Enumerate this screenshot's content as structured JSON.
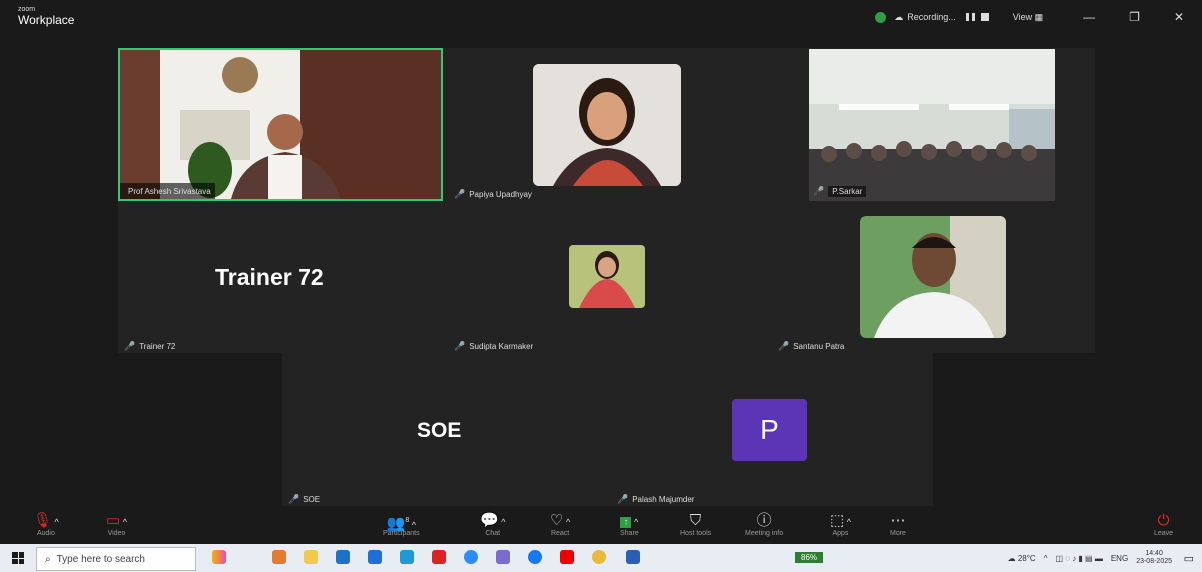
{
  "app": {
    "brand_small": "zoom",
    "brand_big": "Workplace"
  },
  "titlebar": {
    "recording_label": "Recording...",
    "view_label": "View",
    "minimize": "—",
    "restore": "❐",
    "close": "✕"
  },
  "participants": [
    {
      "name": "Prof Ashesh Srivastava",
      "display": "",
      "type": "video",
      "active": true
    },
    {
      "name": "Papiya Upadhyay",
      "display": "",
      "type": "video"
    },
    {
      "name": "P.Sarkar",
      "display": "",
      "type": "video"
    },
    {
      "name": "Trainer 72",
      "display": "Trainer 72",
      "type": "name-only"
    },
    {
      "name": "Sudipta Karmaker",
      "display": "",
      "type": "video"
    },
    {
      "name": "Santanu Patra",
      "display": "",
      "type": "video"
    },
    {
      "name": "SOE",
      "display": "SOE",
      "type": "name-only"
    },
    {
      "name": "Palash Majumder",
      "display": "P",
      "type": "avatar",
      "avatar_color": "#5b35b6"
    }
  ],
  "toolbar": {
    "audio": "Audio",
    "video": "Video",
    "participants": "Participants",
    "participants_count": "8",
    "chat": "Chat",
    "react": "React",
    "share": "Share",
    "host_tools": "Host tools",
    "meeting_info": "Meeting info",
    "apps": "Apps",
    "more": "More",
    "leave": "Leave"
  },
  "taskbar": {
    "search_placeholder": "Type here to search",
    "battery": "86%",
    "weather": "28°C",
    "lang": "ENG",
    "time": "14:40",
    "date": "23-08-2025"
  },
  "colors": {
    "accent_green": "#2ea043",
    "mute_red": "#e02828",
    "active_border": "#2ecc71",
    "share_green": "#2ea043"
  }
}
